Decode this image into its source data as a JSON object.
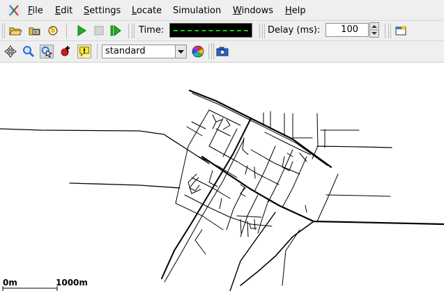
{
  "menubar": {
    "app_icon": "sumo-logo-icon",
    "items": [
      {
        "label": "File",
        "underline": "F",
        "rest": "ile"
      },
      {
        "label": "Edit",
        "underline": "E",
        "rest": "dit"
      },
      {
        "label": "Settings",
        "underline": "S",
        "rest": "ettings"
      },
      {
        "label": "Locate",
        "underline": "L",
        "rest": "ocate"
      },
      {
        "label": "Simulation",
        "underline": "",
        "rest": "Simulation"
      },
      {
        "label": "Windows",
        "underline": "W",
        "rest": "indows"
      },
      {
        "label": "Help",
        "underline": "H",
        "rest": "elp"
      }
    ]
  },
  "toolbar": {
    "buttons": [
      "open-folder-icon",
      "open-network-icon",
      "reload-icon",
      "run-icon",
      "stop-icon",
      "step-icon",
      "new-view-icon"
    ],
    "time_label": "Time:",
    "time_value": "- - - - - - - - - - - - - -",
    "delay_label": "Delay (ms):",
    "delay_value": "100"
  },
  "toolbar2": {
    "buttons": [
      "recenter-view-icon",
      "locate-icon",
      "select-icon",
      "breakpoint-icon",
      "info-icon",
      "color-wheel-icon",
      "screenshot-icon"
    ],
    "scheme_select": "standard"
  },
  "colors": {
    "chrome": "#efefef",
    "time_display_bg": "#000000",
    "time_display_fg": "#12c912",
    "canvas": "#ffffff",
    "roads": "#000000"
  },
  "scale_bar": {
    "start_label": "0m",
    "end_label": "1000m"
  }
}
